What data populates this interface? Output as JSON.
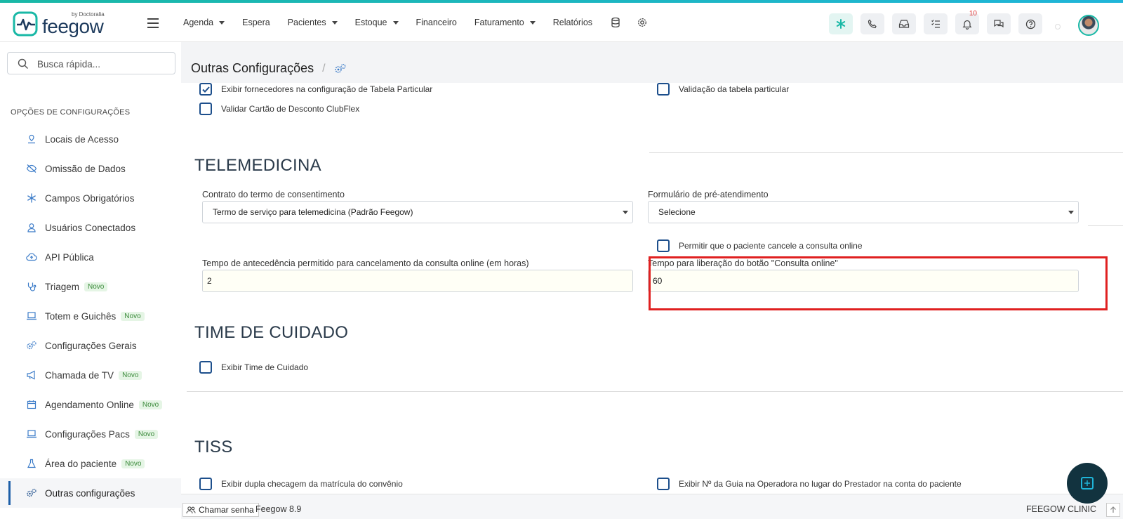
{
  "app": {
    "logo_text": "feegow",
    "logo_by": "by Doctoralia"
  },
  "nav": {
    "items": [
      {
        "label": "Agenda",
        "caret": true
      },
      {
        "label": "Espera",
        "caret": false
      },
      {
        "label": "Pacientes",
        "caret": true
      },
      {
        "label": "Estoque",
        "caret": true
      },
      {
        "label": "Financeiro",
        "caret": false
      },
      {
        "label": "Faturamento",
        "caret": true
      },
      {
        "label": "Relatórios",
        "caret": false
      }
    ],
    "notification_count": "10"
  },
  "search": {
    "placeholder": "Busca rápida..."
  },
  "sidebar": {
    "heading": "OPÇÕES DE CONFIGURAÇÕES",
    "items": [
      {
        "label": "Locais de Acesso",
        "icon": "location-pin-icon",
        "novo": false
      },
      {
        "label": "Omissão de Dados",
        "icon": "eye-off-icon",
        "novo": false
      },
      {
        "label": "Campos Obrigatórios",
        "icon": "asterisk-icon",
        "novo": false
      },
      {
        "label": "Usuários Conectados",
        "icon": "user-icon",
        "novo": false
      },
      {
        "label": "API Pública",
        "icon": "cloud-upload-icon",
        "novo": false
      },
      {
        "label": "Triagem",
        "icon": "stethoscope-icon",
        "novo": true
      },
      {
        "label": "Totem e Guichês",
        "icon": "laptop-icon",
        "novo": true
      },
      {
        "label": "Configurações Gerais",
        "icon": "gears-icon",
        "novo": false
      },
      {
        "label": "Chamada de TV",
        "icon": "megaphone-icon",
        "novo": true
      },
      {
        "label": "Agendamento Online",
        "icon": "calendar-icon",
        "novo": true
      },
      {
        "label": "Configurações Pacs",
        "icon": "laptop-icon",
        "novo": true
      },
      {
        "label": "Área do paciente",
        "icon": "flask-icon",
        "novo": true
      },
      {
        "label": "Outras configurações",
        "icon": "gears-icon",
        "novo": false,
        "active": true
      }
    ],
    "novo_label": "Novo"
  },
  "page": {
    "title": "Outras Configurações"
  },
  "content": {
    "cb_fornecedores": "Exibir fornecedores na configuração de Tabela Particular",
    "cb_validacao_tabela": "Validação da tabela particular",
    "cb_clubflex": "Validar Cartão de Desconto ClubFlex",
    "telemedicina": {
      "heading": "TELEMEDICINA",
      "contrato_label": "Contrato do termo de consentimento",
      "contrato_value": "Termo de serviço para telemedicina (Padrão Feegow)",
      "formulario_label": "Formulário de pré-atendimento",
      "formulario_value": "Selecione",
      "cb_cancelar": "Permitir que o paciente cancele a consulta online",
      "antecedencia_label": "Tempo de antecedência permitido para cancelamento da consulta online (em horas)",
      "antecedencia_value": "2",
      "liberacao_label": "Tempo para liberação do botão \"Consulta online\"",
      "liberacao_value": "60"
    },
    "time_cuidado": {
      "heading": "TIME DE CUIDADO",
      "cb_exibir": "Exibir Time de Cuidado"
    },
    "tiss": {
      "heading": "TISS",
      "cb_dupla": "Exibir dupla checagem da matrícula do convênio",
      "cb_guia": "Exibir Nº da Guia na Operadora no lugar do Prestador na conta do paciente"
    }
  },
  "footer": {
    "chamar_senha": "Chamar senha",
    "version": "Feegow 8.9",
    "clinic": "FEEGOW CLINIC"
  },
  "colors": {
    "accent": "#19b8a6",
    "checkbox_border": "#1d4f8c",
    "highlight": "#e02020"
  }
}
